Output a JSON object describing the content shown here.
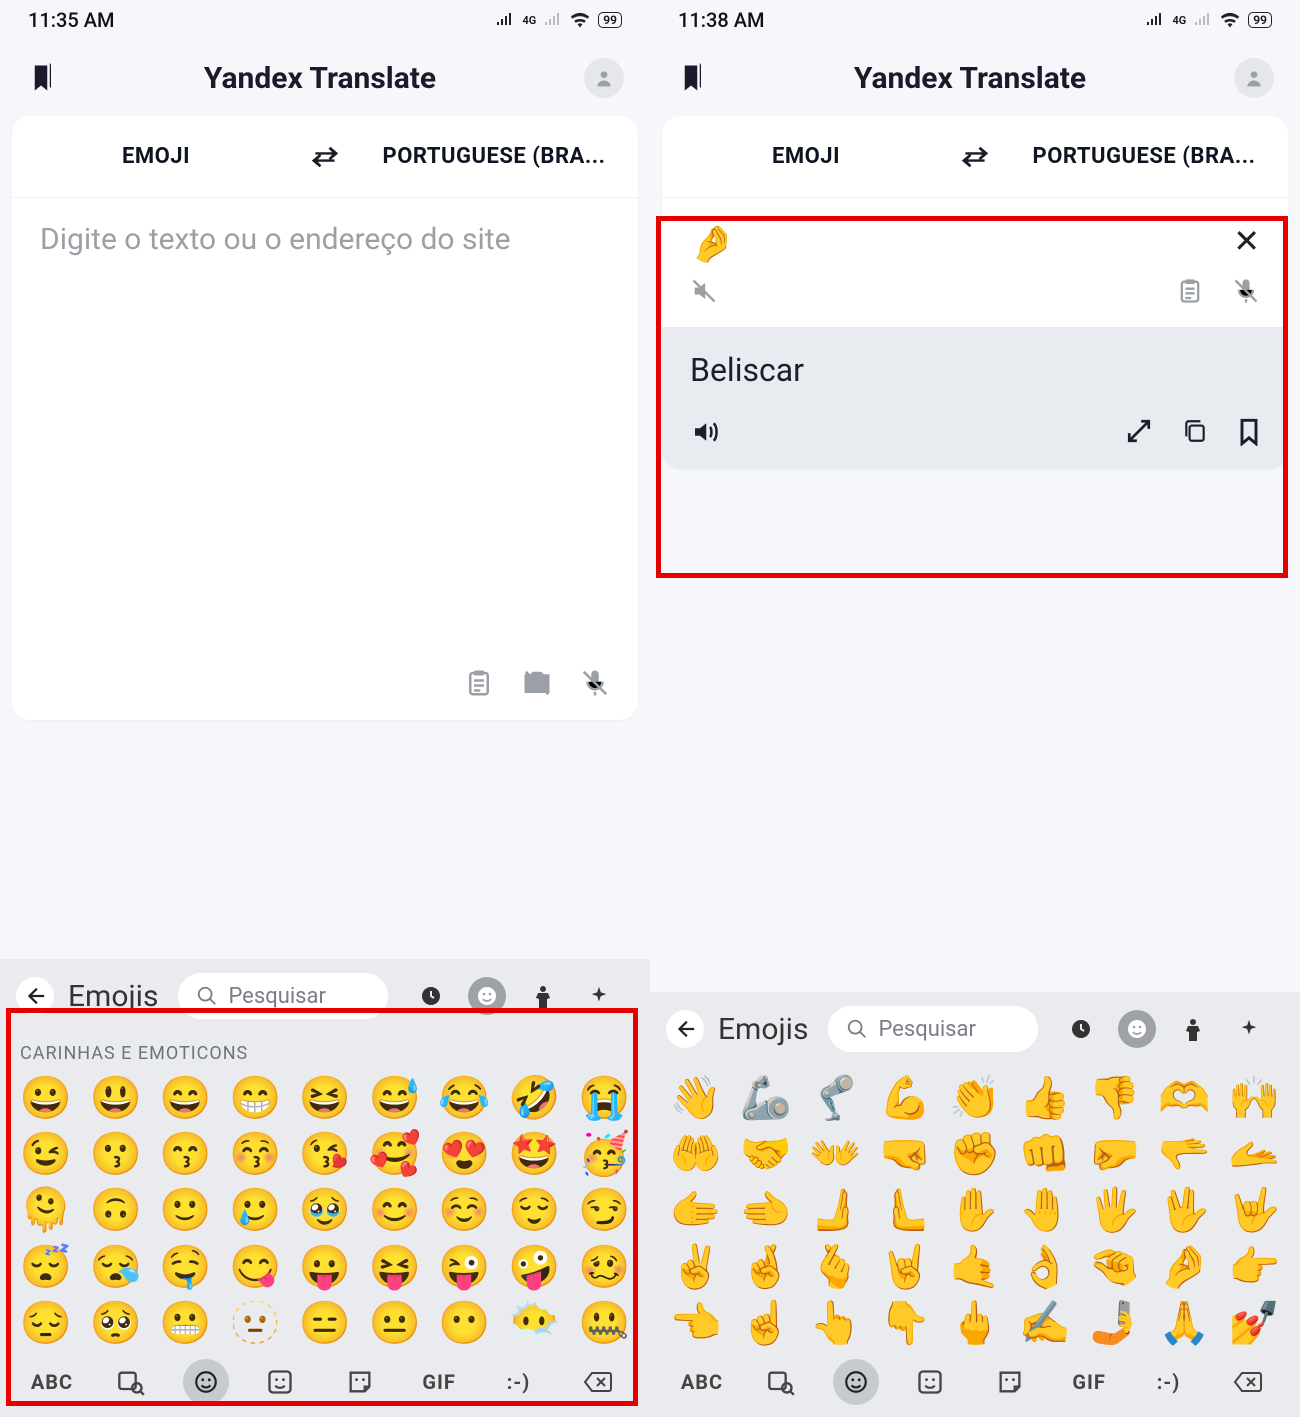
{
  "left": {
    "status": {
      "time": "11:35 AM",
      "net_label": "4G",
      "battery": "99"
    },
    "app_title": "Yandex Translate",
    "langs": {
      "from": "EMOJI",
      "to": "PORTUGUESE (BRA..."
    },
    "input_placeholder": "Digite o texto ou o endereço do site",
    "keyboard": {
      "title": "Emojis",
      "search_placeholder": "Pesquisar",
      "section_label": "CARINHAS E EMOTICONS",
      "abc": "ABC",
      "gif": "GIF",
      "smiley_text": ":-)"
    },
    "emoji_rows": [
      [
        "😀",
        "😃",
        "😄",
        "😁",
        "😆",
        "😅",
        "😂",
        "🤣",
        "😭"
      ],
      [
        "😉",
        "😗",
        "😙",
        "😚",
        "😘",
        "🥰",
        "😍",
        "🤩",
        "🥳"
      ],
      [
        "🫠",
        "🙃",
        "🙂",
        "🥲",
        "🥹",
        "😊",
        "☺️",
        "😌",
        "😏"
      ],
      [
        "😴",
        "😪",
        "🤤",
        "😋",
        "😛",
        "😝",
        "😜",
        "🤪",
        "🥴"
      ],
      [
        "😔",
        "🥺",
        "😬",
        "🫥",
        "😑",
        "😐",
        "😶",
        "😶‍🌫️",
        "🤐"
      ]
    ]
  },
  "right": {
    "status": {
      "time": "11:38 AM",
      "net_label": "4G",
      "battery": "99"
    },
    "app_title": "Yandex Translate",
    "langs": {
      "from": "EMOJI",
      "to": "PORTUGUESE (BRA..."
    },
    "input_emoji": "🤌",
    "translation": "Beliscar",
    "keyboard": {
      "title": "Emojis",
      "search_placeholder": "Pesquisar",
      "abc": "ABC",
      "gif": "GIF",
      "smiley_text": ":-)"
    },
    "emoji_rows": [
      [
        "👋",
        "🦾",
        "🦿",
        "💪",
        "👏",
        "👍",
        "👎",
        "🫶",
        "🙌"
      ],
      [
        "🤲",
        "🤝",
        "👐",
        "🤜",
        "✊",
        "👊",
        "🤛",
        "🫳",
        "🫴"
      ],
      [
        "🫱",
        "🫲",
        "🫸",
        "🫷",
        "✋",
        "🤚",
        "🖐️",
        "🖖",
        "🤟"
      ],
      [
        "✌️",
        "🤞",
        "🫰",
        "🤘",
        "🤙",
        "👌",
        "🤏",
        "🤌",
        "👉"
      ],
      [
        "👈",
        "☝️",
        "👆",
        "👇",
        "🖕",
        "✍️",
        "🤳",
        "🙏",
        "💅"
      ]
    ]
  }
}
